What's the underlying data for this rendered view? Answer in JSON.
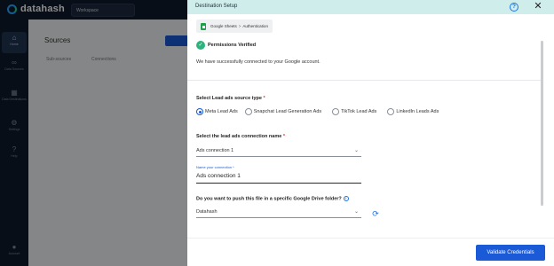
{
  "app": {
    "logo_text": "datahash",
    "workspace": "Workspace",
    "sidebar": {
      "items": [
        {
          "label": "Home",
          "icon": "home-icon",
          "glyph": "⌂"
        },
        {
          "label": "Data Sources",
          "icon": "sources-icon",
          "glyph": "∞"
        },
        {
          "label": "Data Destinations",
          "icon": "destinations-icon",
          "glyph": "▦"
        },
        {
          "label": "Settings",
          "icon": "settings-icon",
          "glyph": "⚙"
        },
        {
          "label": "Help",
          "icon": "help-icon",
          "glyph": "?"
        }
      ],
      "bottom_label": "Account"
    },
    "page_title": "Sources",
    "filters": [
      "Sub-sources",
      "Connections"
    ]
  },
  "drawer": {
    "title": "Destination Setup",
    "breadcrumb": {
      "parent": "Google Sheets",
      "separator": ">",
      "current": "Authentication"
    },
    "verified_text": "Permissions Verified",
    "success_message": "We have successfully connected to your Google account.",
    "lead_type": {
      "label": "Select Lead ads source type",
      "required_mark": "*",
      "options": [
        {
          "label": "Meta Lead Ads",
          "checked": true
        },
        {
          "label": "Snapchat Lead Generation Ads",
          "checked": false
        },
        {
          "label": "TikTok Lead Ads",
          "checked": false
        },
        {
          "label": "LinkedIn Leads Ads",
          "checked": false
        }
      ]
    },
    "connection": {
      "label": "Select the lead ads connection name",
      "required_mark": "*",
      "value": "Ads connection 1"
    },
    "connection_name": {
      "label": "Name your connection",
      "required_mark": "*",
      "value": "Ads connection 1"
    },
    "drive_folder": {
      "label": "Do you want to push this file in a specific Google Drive folder?",
      "value": "Datahash"
    },
    "validate_button": "Validate Credentials"
  },
  "colors": {
    "accent": "#1a5ad6",
    "header_bg": "#cfeeeb",
    "success": "#2db37e",
    "app_dark": "#0f1b2d"
  }
}
